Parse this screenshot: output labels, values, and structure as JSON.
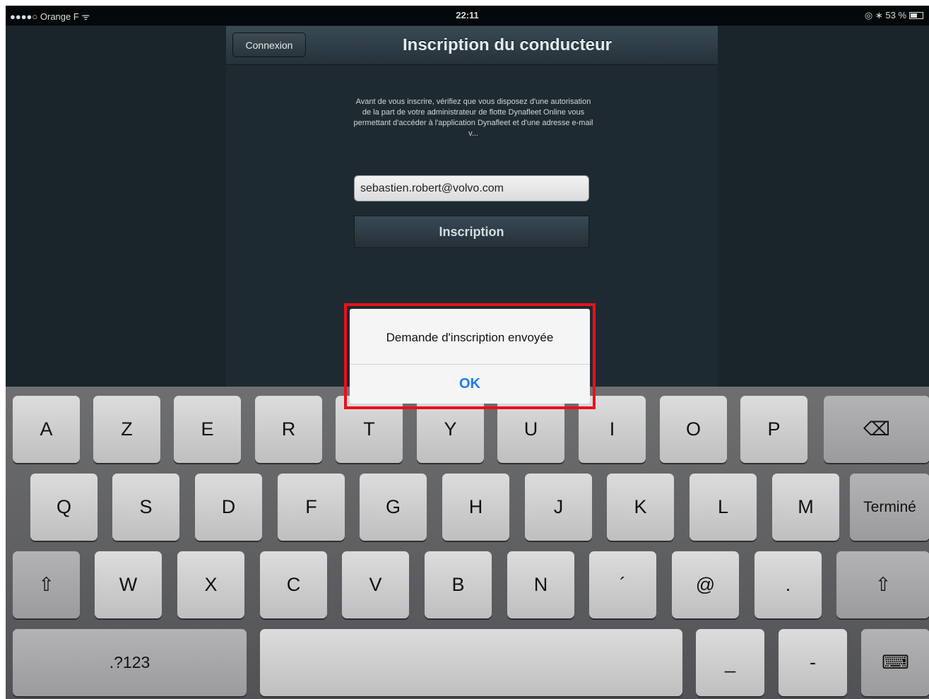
{
  "status_bar": {
    "carrier": "●●●●○ Orange F ᯤ",
    "time": "22:11",
    "battery": "◎ ∗ 53 %"
  },
  "navbar": {
    "back_button": "Connexion",
    "title": "Inscription du conducteur"
  },
  "form": {
    "intro_text": "Avant de vous inscrire, vérifiez que vous disposez d'une autorisation de la part de votre administrateur de flotte Dynafleet Online vous permettant d'accéder à l'application Dynafleet et d'une adresse e-mail v...",
    "email_value": "sebastien.robert@volvo.com",
    "submit_label": "Inscription"
  },
  "alert": {
    "message": "Demande d'inscription envoyée",
    "ok_label": "OK",
    "highlight_color": "#e8111a"
  },
  "keyboard": {
    "row1": [
      "A",
      "Z",
      "E",
      "R",
      "T",
      "Y",
      "U",
      "I",
      "O",
      "P"
    ],
    "backspace_icon": "⌫",
    "row2": [
      "Q",
      "S",
      "D",
      "F",
      "G",
      "H",
      "J",
      "K",
      "L",
      "M"
    ],
    "done_label": "Terminé",
    "shift_icon": "⇧",
    "row3": [
      "W",
      "X",
      "C",
      "V",
      "B",
      "N",
      "´",
      "@",
      "."
    ],
    "numbers_label": ".?123",
    "underscore": "_",
    "dash": "-",
    "hide_keyboard_icon": "⌨"
  }
}
